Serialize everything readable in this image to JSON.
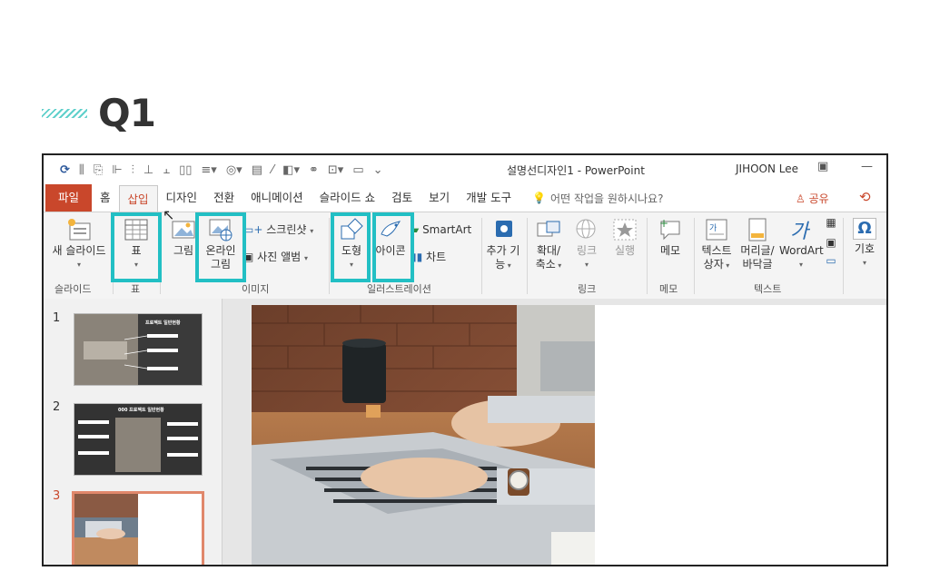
{
  "heading": {
    "label": "Q1"
  },
  "titlebar": {
    "title": "설명선디자인1  -  PowerPoint",
    "user": "JIHOON Lee",
    "restore_icon": "restore-window-icon",
    "minimize_icon": "minimize-window-icon"
  },
  "tabs": [
    "파일",
    "홈",
    "삽입",
    "디자인",
    "전환",
    "애니메이션",
    "슬라이드 쇼",
    "검토",
    "보기",
    "개발 도구"
  ],
  "tell_me": "어떤 작업을 원하시나요?",
  "share": "공유",
  "ribbon": {
    "new_slide": "새 슬라이드",
    "table": "표",
    "picture": "그림",
    "online_picture_1": "온라인",
    "online_picture_2": "그림",
    "screenshot": "스크린샷",
    "photo_album": "사진 앨범",
    "shapes": "도형",
    "icons": "아이콘",
    "smartart": "SmartArt",
    "chart": "차트",
    "addin_1": "추가 기",
    "addin_2": "능",
    "zoom_1": "확대/",
    "zoom_2": "축소",
    "link": "링크",
    "action": "실행",
    "comment": "메모",
    "textbox_1": "텍스트",
    "textbox_2": "상자",
    "header_1": "머리글/",
    "header_2": "바닥글",
    "wordart": "WordArt",
    "symbol": "기호",
    "groups": {
      "slide": "슬라이드",
      "table": "표",
      "images": "이미지",
      "illustrations": "일러스트레이션",
      "links": "링크",
      "comments": "메모",
      "text": "텍스트"
    }
  },
  "slides": [
    {
      "num": "1",
      "title": "프로젝트 일반현황"
    },
    {
      "num": "2",
      "title": "000 프로젝트 일반현황"
    },
    {
      "num": "3",
      "title": ""
    }
  ],
  "colors": {
    "accent": "#c9472b",
    "highlight": "#22bfc4",
    "hatch": "#5fd0cb"
  }
}
